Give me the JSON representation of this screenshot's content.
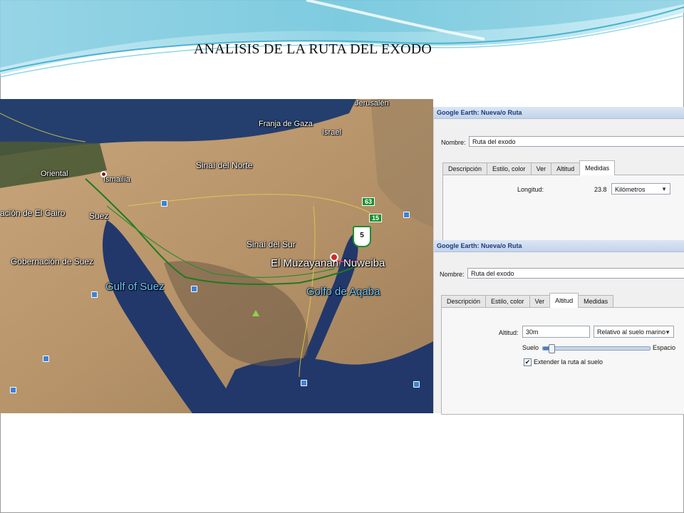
{
  "slide": {
    "title": "ANALISIS DE LA RUTA DEL EXODO"
  },
  "map": {
    "labels": {
      "jerusalen": "Jerusalén",
      "franja_gaza": "Franja de Gaza",
      "israel": "Israel",
      "oriental": "Oriental",
      "ismailia": "Ismailía",
      "sinai_norte": "Sinaí del Norte",
      "cairo": "ación de El Cairo",
      "suez": "Suez",
      "sinai_sur": "Sinaí del Sur",
      "gob_suez": "Gobernación de Suez",
      "muzayanah": "El Muzayanah",
      "nuweiba": "Nuweiba",
      "gulf_suez": "Gulf of Suez",
      "golfo_aqaba": "Golfo de Aqaba"
    },
    "road_badges": {
      "b63": "63",
      "b15": "15"
    },
    "shield_number": "5"
  },
  "dialog1": {
    "title": "Google Earth: Nueva/o Ruta",
    "name_label": "Nombre:",
    "name_value": "Ruta del exodo",
    "tabs": [
      "Descripción",
      "Estilo, color",
      "Ver",
      "Altitud",
      "Medidas"
    ],
    "active_tab": "Medidas",
    "length_label": "Longitud:",
    "length_value": "23.8",
    "length_unit": "Kilómetros"
  },
  "dialog2": {
    "title": "Google Earth: Nueva/o Ruta",
    "name_label": "Nombre:",
    "name_value": "Ruta del exodo",
    "tabs": [
      "Descripción",
      "Estilo, color",
      "Ver",
      "Altitud",
      "Medidas"
    ],
    "active_tab": "Altitud",
    "altitude_label": "Altitud:",
    "altitude_value": "30m",
    "altitude_mode": "Relativo al suelo marino",
    "slider_min_label": "Suelo",
    "slider_max_label": "Espacio",
    "slider_level": 0.08,
    "extend_label": "Extender la ruta al suelo",
    "extend_checked": true
  },
  "colors": {
    "water": "#1f3f7a",
    "desert": "#c4a27a",
    "route": "#1f7a1f",
    "dialog_title": "#1a3c7a"
  }
}
